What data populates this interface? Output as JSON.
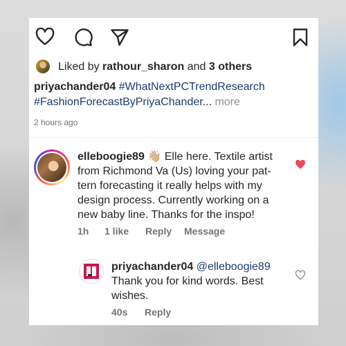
{
  "post": {
    "likes_prefix": "Liked by",
    "liked_by_user": "rathour_sharon",
    "and_word": "and",
    "others": "3 others",
    "caption_user": "priyachander04",
    "hashtag1": "#WhatNextPCTrendResearch",
    "hashtag2": "#FashionForecastByPriyaChander",
    "ellipsis": "...",
    "more": "more",
    "time": "2 hours ago"
  },
  "comment": {
    "user": "elleboogie89",
    "emoji": "👋🏼",
    "line1": "Elle here. Textile artist",
    "line2": "from Richmond Va (Us) loving your pat-",
    "line3": "tern forecasting it really helps with my",
    "line4": "design process. Currently working on a",
    "line5": "new baby line. Thanks for the inspo!",
    "time": "1h",
    "likes": "1 like",
    "reply": "Reply",
    "message": "Message",
    "like_color": "#ed4956"
  },
  "reply": {
    "user": "priyachander04",
    "mention": "@elleboogie89",
    "line1": "Thank you for kind words. Best",
    "line2": "wishes.",
    "time": "40s",
    "reply": "Reply"
  },
  "icons": [
    "heart-icon",
    "comment-icon",
    "share-icon",
    "bookmark-icon"
  ]
}
